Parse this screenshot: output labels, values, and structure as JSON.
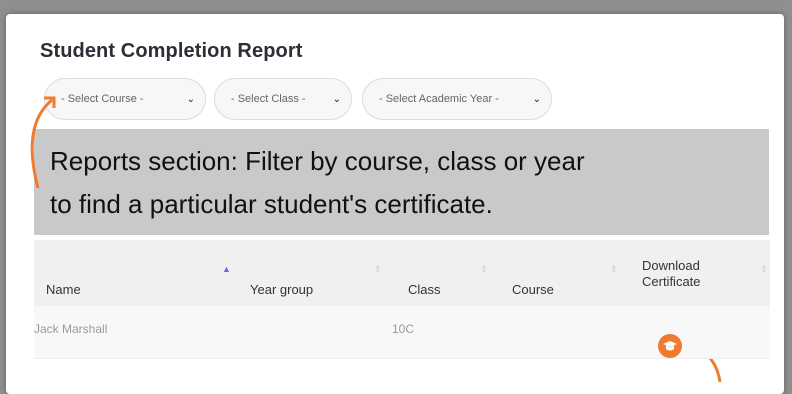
{
  "report": {
    "title": "Student Completion Report",
    "filters": {
      "course": "- Select Course -",
      "class": "- Select Class -",
      "academic_year": "- Select Academic Year -"
    }
  },
  "annotation": {
    "line1": "Reports section: Filter by course, class or year",
    "line2": "to find a particular student's certificate."
  },
  "table": {
    "columns": {
      "name": "Name",
      "year_group": "Year group",
      "class": "Class",
      "course": "Course",
      "download_line1": "Download",
      "download_line2": "Certificate"
    },
    "rows": [
      {
        "name": "Jack Marshall",
        "year_group": "",
        "class": "10C",
        "course": ""
      }
    ]
  },
  "colors": {
    "accent": "#f07a2e",
    "banner": "#c9c9c9",
    "sort_active": "#5b6de0"
  },
  "icons": {
    "download": "graduation-cap-icon"
  }
}
